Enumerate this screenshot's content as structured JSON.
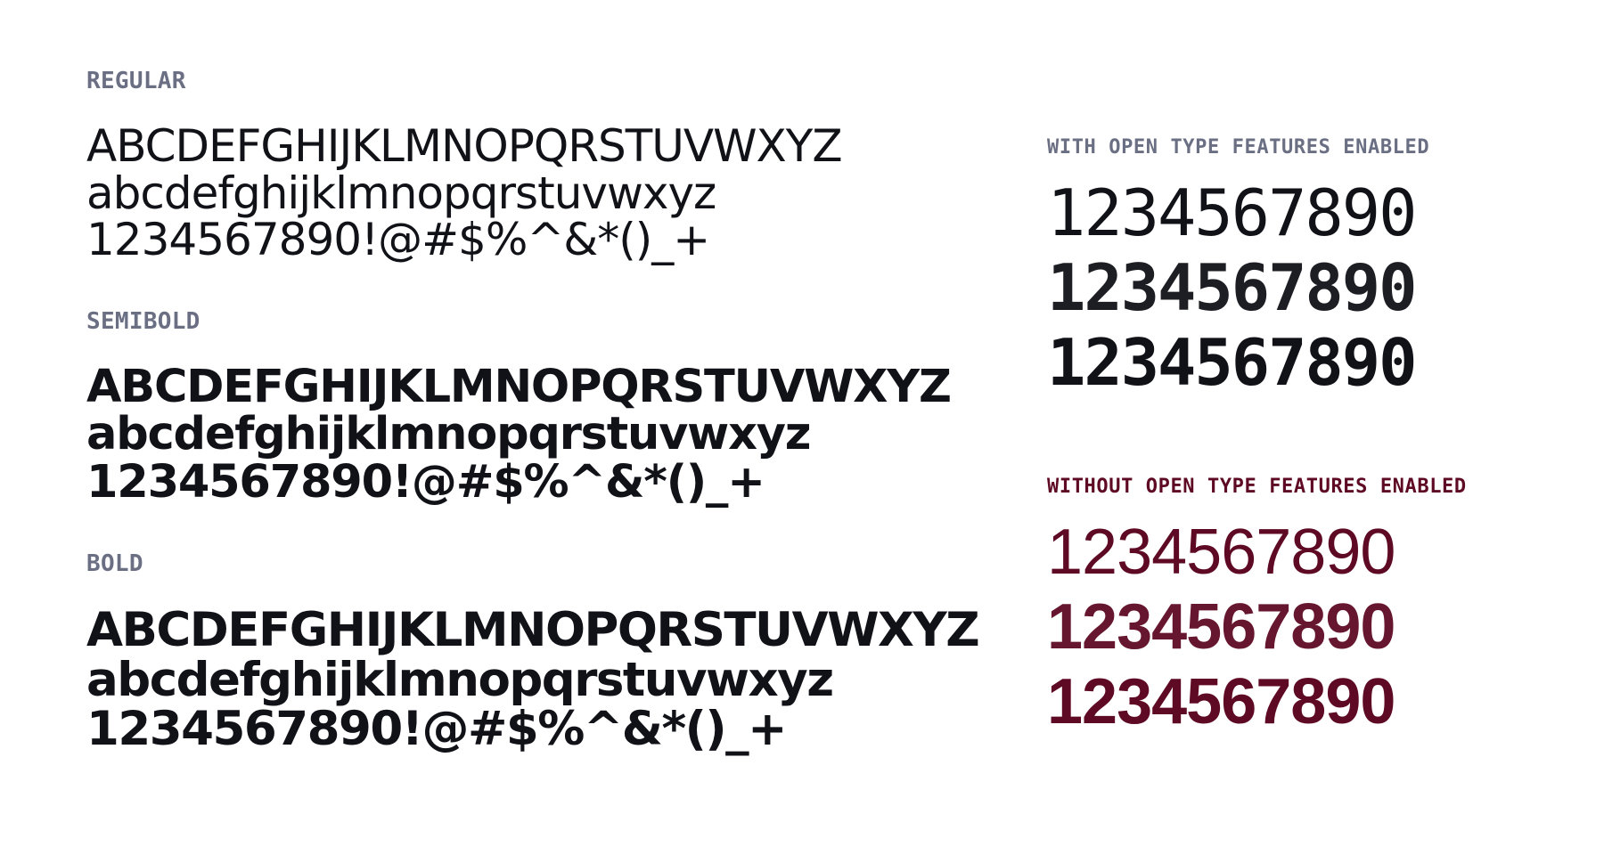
{
  "left": {
    "sections": [
      {
        "label": "REGULAR",
        "uppercase": "ABCDEFGHIJKLMNOPQRSTUVWXYZ",
        "lowercase": "abcdefghijklmnopqrstuvwxyz",
        "digits": "1234567890!@#$%^&*()_+"
      },
      {
        "label": "SEMIBOLD",
        "uppercase": "ABCDEFGHIJKLMNOPQRSTUVWXYZ",
        "lowercase": "abcdefghijklmnopqrstuvwxyz",
        "digits": "1234567890!@#$%^&*()_+"
      },
      {
        "label": "BOLD",
        "uppercase": "ABCDEFGHIJKLMNOPQRSTUVWXYZ",
        "lowercase": "abcdefghijklmnopqrstuvwxyz",
        "digits": "1234567890!@#$%^&*()_+"
      }
    ]
  },
  "right": {
    "with_features": {
      "label": "WITH OPEN TYPE FEATURES ENABLED",
      "rows": [
        "1234567890",
        "1234567890",
        "1234567890"
      ]
    },
    "without_features": {
      "label": "WITHOUT OPEN TYPE FEATURES ENABLED",
      "rows": [
        "1234567890",
        "1234567890",
        "1234567890"
      ]
    }
  },
  "colors": {
    "text": "#111218",
    "label_muted": "#6b6f83",
    "accent": "#5e0a24",
    "background": "#ffffff"
  }
}
